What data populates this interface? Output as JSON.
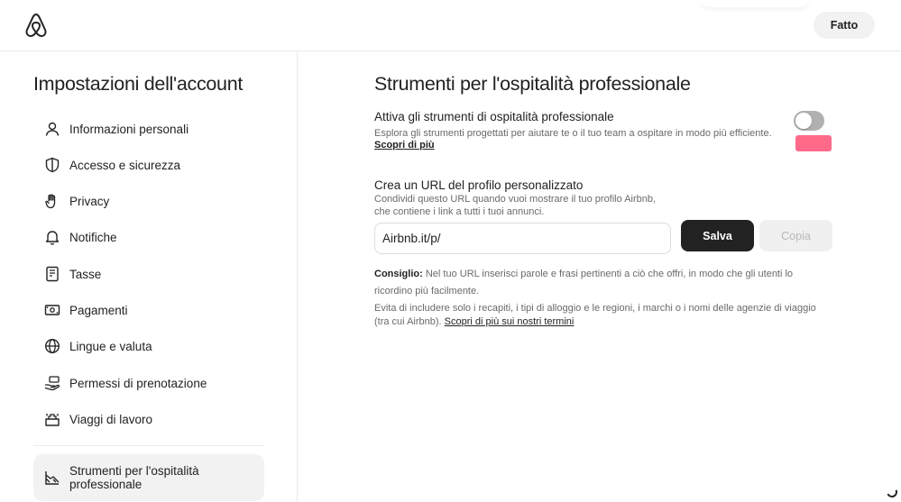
{
  "header": {
    "logo_icon": "airbnb-logo-icon",
    "done_label": "Fatto"
  },
  "sidebar": {
    "title": "Impostazioni dell'account",
    "items": [
      {
        "label": "Informazioni personali",
        "icon": "person-icon"
      },
      {
        "label": "Accesso e sicurezza",
        "icon": "shield-icon"
      },
      {
        "label": "Privacy",
        "icon": "hand-icon"
      },
      {
        "label": "Notifiche",
        "icon": "bell-icon"
      },
      {
        "label": "Tasse",
        "icon": "document-icon"
      },
      {
        "label": "Pagamenti",
        "icon": "money-icon"
      },
      {
        "label": "Lingue e valuta",
        "icon": "globe-icon"
      },
      {
        "label": "Permessi di prenotazione",
        "icon": "hand-money-icon"
      },
      {
        "label": "Viaggi di lavoro",
        "icon": "briefcase-icon"
      },
      {
        "label": "Strumenti per l'ospitalità professionale",
        "icon": "chart-icon",
        "active": true
      }
    ]
  },
  "main": {
    "title": "Strumenti per l'ospitalità professionale",
    "professional_tools": {
      "title": "Attiva gli strumenti di ospitalità professionale",
      "description": "Esplora gli strumenti progettati per aiutare te o il tuo team a ospitare in modo più efficiente.",
      "link": "Scopri di più",
      "toggle_on": false
    },
    "profile_url": {
      "title": "Crea un URL del profilo personalizzato",
      "description_line1": "Condividi questo URL quando vuoi mostrare il tuo profilo Airbnb,",
      "description_line2": "che contiene i link a tutti i tuoi annunci.",
      "input_value": "Airbnb.it/p/",
      "save_label": "Salva",
      "copy_label": "Copia"
    },
    "tip": {
      "label": "Consiglio:",
      "text": "Nel tuo URL inserisci parole e frasi pertinenti a ciò che offri, in modo che gli utenti lo ricordino più facilmente."
    },
    "note": {
      "text": "Evita di includere solo i recapiti, i tipi di alloggio e le regioni, i marchi o i nomi delle agenzie di viaggio (tra cui Airbnb).",
      "link": "Scopri di più sui nostri termini"
    }
  },
  "colors": {
    "text": "#222222",
    "muted": "#6a6a6a",
    "save_bg": "#222222",
    "toggle_off": "#b0b0b0",
    "redaction": "#ff5a7e"
  }
}
